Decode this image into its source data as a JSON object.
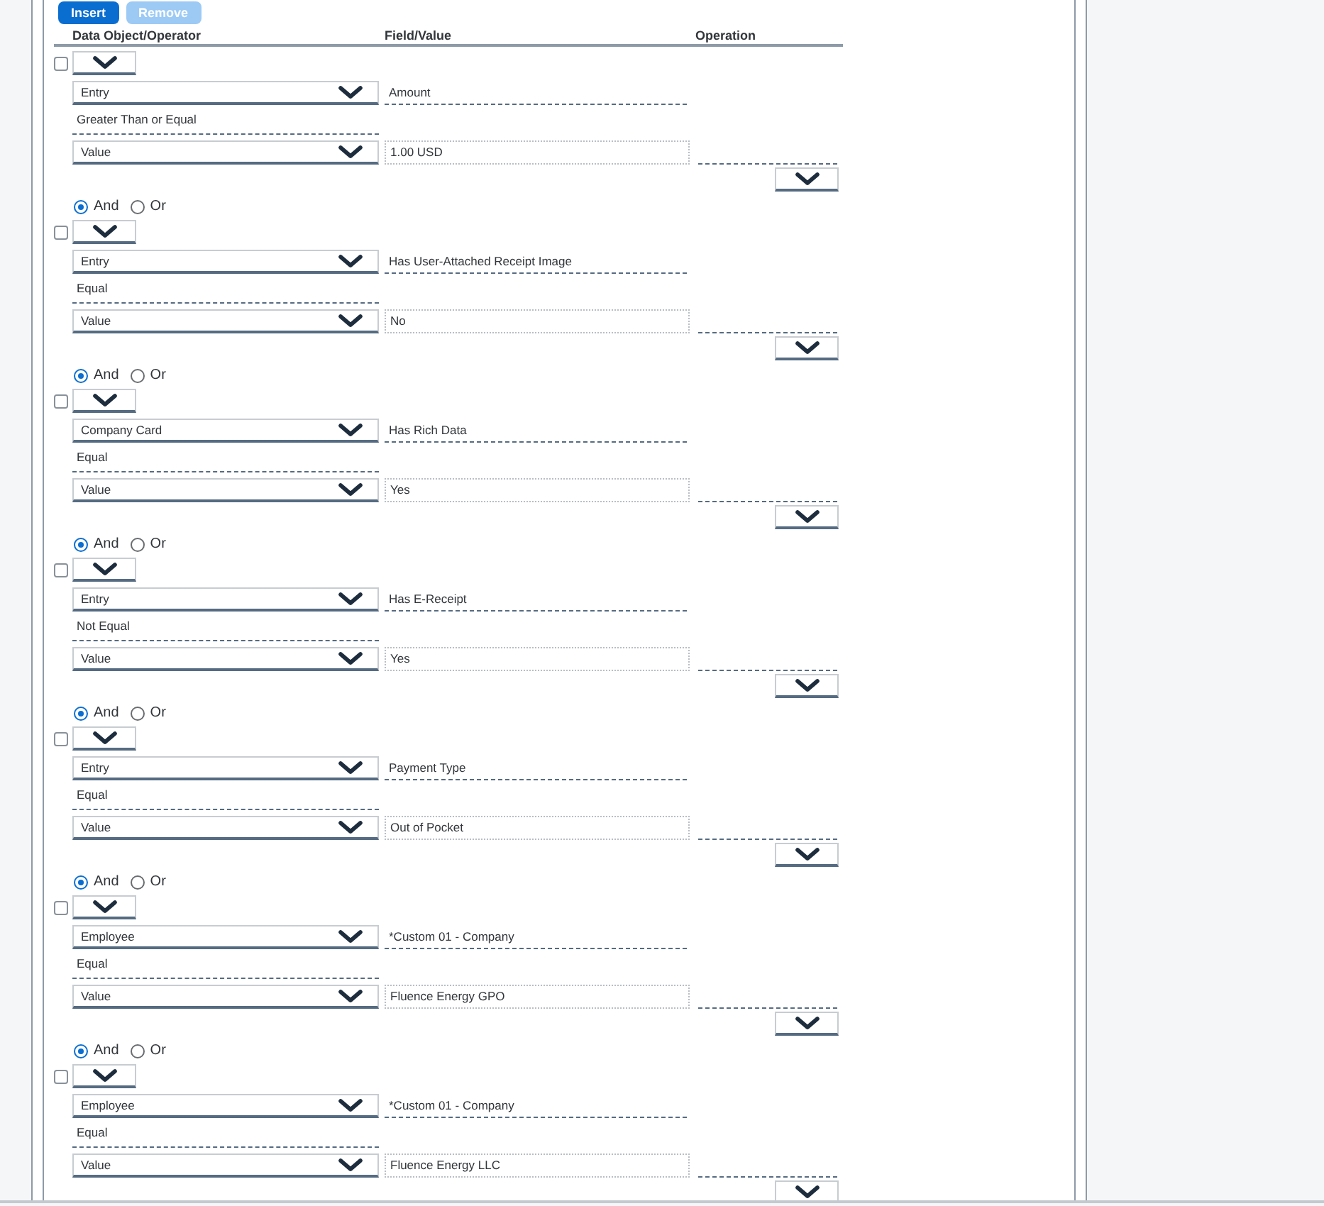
{
  "toolbar": {
    "buttons": [
      {
        "label": "Insert",
        "disabled": false
      },
      {
        "label": "Remove",
        "disabled": true
      }
    ]
  },
  "columns": [
    "Data Object/Operator",
    "Field/Value",
    "Operation"
  ],
  "conditions": [
    {
      "checked": false,
      "object": "Entry",
      "field": "Amount",
      "operator": "Greater Than or Equal",
      "value_type": "Value",
      "value": "1.00 USD"
    },
    {
      "connector": [
        {
          "label": "And",
          "selected": true
        },
        {
          "label": "Or",
          "selected": false
        }
      ],
      "checked": false,
      "object": "Entry",
      "field": "Has User-Attached Receipt Image",
      "operator": "Equal",
      "value_type": "Value",
      "value": "No"
    },
    {
      "connector": [
        {
          "label": "And",
          "selected": true
        },
        {
          "label": "Or",
          "selected": false
        }
      ],
      "checked": false,
      "object": "Company Card",
      "field": "Has Rich Data",
      "operator": "Equal",
      "value_type": "Value",
      "value": "Yes"
    },
    {
      "connector": [
        {
          "label": "And",
          "selected": true
        },
        {
          "label": "Or",
          "selected": false
        }
      ],
      "checked": false,
      "object": "Entry",
      "field": "Has E-Receipt",
      "operator": "Not Equal",
      "value_type": "Value",
      "value": "Yes"
    },
    {
      "connector": [
        {
          "label": "And",
          "selected": true
        },
        {
          "label": "Or",
          "selected": false
        }
      ],
      "checked": false,
      "object": "Entry",
      "field": "Payment Type",
      "operator": "Equal",
      "value_type": "Value",
      "value": "Out of Pocket"
    },
    {
      "connector": [
        {
          "label": "And",
          "selected": true
        },
        {
          "label": "Or",
          "selected": false
        }
      ],
      "checked": false,
      "object": "Employee",
      "field": "*Custom 01 - Company",
      "operator": "Equal",
      "value_type": "Value",
      "value": "Fluence Energy GPO"
    },
    {
      "connector": [
        {
          "label": "And",
          "selected": true
        },
        {
          "label": "Or",
          "selected": false
        }
      ],
      "checked": false,
      "object": "Employee",
      "field": "*Custom 01 - Company",
      "operator": "Equal",
      "value_type": "Value",
      "value": "Fluence Energy LLC"
    }
  ]
}
